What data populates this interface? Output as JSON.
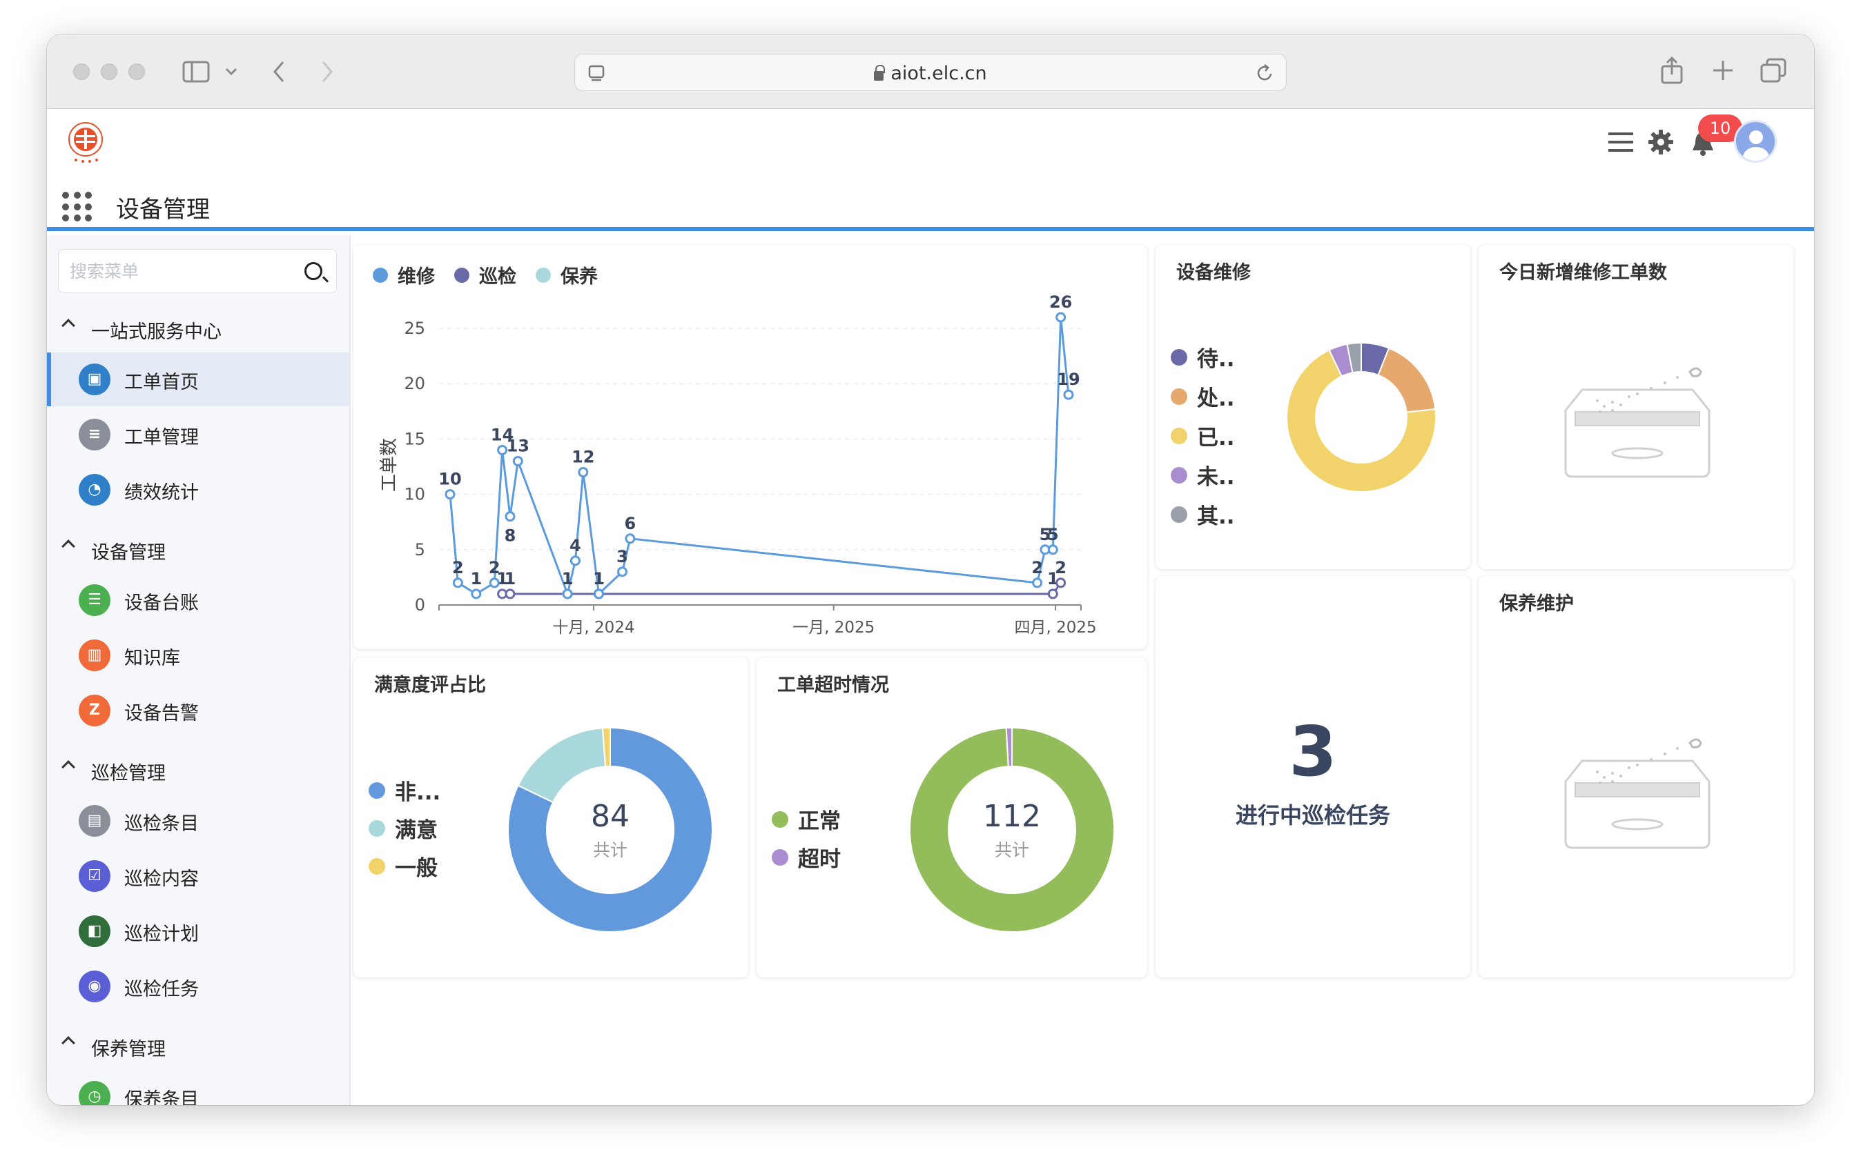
{
  "browser": {
    "url": "aiot.elc.cn"
  },
  "header": {
    "page_title": "设备管理",
    "notification_count": "10"
  },
  "sidebar": {
    "search_placeholder": "搜索菜单",
    "groups": [
      {
        "label": "一站式服务中心",
        "items": [
          {
            "label": "工单首页",
            "icon": "clipboard-icon",
            "color": "#2f7fc9"
          },
          {
            "label": "工单管理",
            "icon": "list-icon",
            "color": "#8a8f99"
          },
          {
            "label": "绩效统计",
            "icon": "chart-icon",
            "color": "#2f7fc9"
          }
        ]
      },
      {
        "label": "设备管理",
        "items": [
          {
            "label": "设备台账",
            "icon": "ledger-icon",
            "color": "#4caf50"
          },
          {
            "label": "知识库",
            "icon": "book-icon",
            "color": "#f06a3a"
          },
          {
            "label": "设备告警",
            "icon": "alarm-icon",
            "color": "#f06a3a"
          }
        ]
      },
      {
        "label": "巡检管理",
        "items": [
          {
            "label": "巡检条目",
            "icon": "document-icon",
            "color": "#8a8f99"
          },
          {
            "label": "巡检内容",
            "icon": "checklist-icon",
            "color": "#5b5fd6"
          },
          {
            "label": "巡检计划",
            "icon": "plan-icon",
            "color": "#2f6e3b"
          },
          {
            "label": "巡检任务",
            "icon": "task-icon",
            "color": "#5b5fd6"
          }
        ]
      },
      {
        "label": "保养管理",
        "items": [
          {
            "label": "保养条目",
            "icon": "clock-icon",
            "color": "#4caf50"
          }
        ]
      }
    ]
  },
  "colors": {
    "accent": "#3f8ee4",
    "repair": "#5b9bdc",
    "inspect": "#6b6aa8",
    "maintain": "#a8d8dc"
  },
  "line_card": {
    "legend": [
      "维修",
      "巡检",
      "保养"
    ],
    "ylabel": "工单数"
  },
  "chart_data": [
    {
      "type": "line",
      "title": "",
      "ylabel": "工单数",
      "ylim": [
        0,
        25
      ],
      "yticks": [
        0,
        5,
        10,
        15,
        20,
        25
      ],
      "xticks": [
        "十月, 2024",
        "一月, 2025",
        "四月, 2025"
      ],
      "series": [
        {
          "name": "维修",
          "color": "#5b9bdc",
          "x": [
            "2024-08-07",
            "2024-08-10",
            "2024-08-17",
            "2024-08-24",
            "2024-08-27",
            "2024-08-30",
            "2024-09-02",
            "2024-09-21",
            "2024-09-24",
            "2024-09-27",
            "2024-10-03",
            "2024-10-12",
            "2024-10-15",
            "2024-03-20",
            "2025-03-20",
            "2025-03-23",
            "2025-03-26",
            "2025-03-29",
            "2025-04-01"
          ],
          "points": [
            {
              "x": "2024-08-07",
              "y": 10
            },
            {
              "x": "2024-08-10",
              "y": 2
            },
            {
              "x": "2024-08-17",
              "y": 1
            },
            {
              "x": "2024-08-24",
              "y": 2
            },
            {
              "x": "2024-08-27",
              "y": 14
            },
            {
              "x": "2024-08-30",
              "y": 8
            },
            {
              "x": "2024-09-02",
              "y": 13
            },
            {
              "x": "2024-09-21",
              "y": 1
            },
            {
              "x": "2024-09-24",
              "y": 4
            },
            {
              "x": "2024-09-27",
              "y": 12
            },
            {
              "x": "2024-10-03",
              "y": 1
            },
            {
              "x": "2024-10-12",
              "y": 3
            },
            {
              "x": "2024-10-15",
              "y": 6
            },
            {
              "x": "2025-03-20",
              "y": 2
            },
            {
              "x": "2025-03-23",
              "y": 5
            },
            {
              "x": "2025-03-26",
              "y": 5
            },
            {
              "x": "2025-03-29",
              "y": 26
            },
            {
              "x": "2025-04-01",
              "y": 19
            }
          ]
        },
        {
          "name": "巡检",
          "color": "#6b6aa8",
          "points": [
            {
              "x": "2024-08-27",
              "y": 1
            },
            {
              "x": "2024-08-30",
              "y": 1
            },
            {
              "x": "2024-09-21",
              "y": 1
            },
            {
              "x": "2024-10-03",
              "y": 1
            },
            {
              "x": "2025-03-26",
              "y": 1
            },
            {
              "x": "2025-03-29",
              "y": 2
            }
          ]
        }
      ]
    },
    {
      "type": "pie",
      "title": "设备维修",
      "legend": [
        "待..",
        "处..",
        "已..",
        "未..",
        "其.."
      ],
      "slices": [
        {
          "label": "待..",
          "value": 6,
          "color": "#6b6aa8"
        },
        {
          "label": "处..",
          "value": 17,
          "color": "#e6a86c"
        },
        {
          "label": "已..",
          "value": 69,
          "color": "#f2d36b"
        },
        {
          "label": "未..",
          "value": 4,
          "color": "#a98dd0"
        },
        {
          "label": "其..",
          "value": 3,
          "color": "#9aa0aa"
        }
      ]
    },
    {
      "type": "pie",
      "title": "满意度评占比",
      "total": "84",
      "total_label": "共计",
      "legend": [
        "非...",
        "满意",
        "一般"
      ],
      "slices": [
        {
          "label": "非...",
          "value": 69,
          "color": "#6199dc"
        },
        {
          "label": "满意",
          "value": 14,
          "color": "#a8d8dc"
        },
        {
          "label": "一般",
          "value": 1,
          "color": "#f2d36b"
        }
      ]
    },
    {
      "type": "pie",
      "title": "工单超时情况",
      "total": "112",
      "total_label": "共计",
      "legend": [
        "正常",
        "超时"
      ],
      "slices": [
        {
          "label": "正常",
          "value": 111,
          "color": "#92bd5a"
        },
        {
          "label": "超时",
          "value": 1,
          "color": "#a98dd0"
        }
      ]
    }
  ],
  "cards": {
    "repair_title": "设备维修",
    "new_today_title": "今日新增维修工单数",
    "satisfaction_title": "满意度评占比",
    "timeout_title": "工单超时情况",
    "inspect_count": "3",
    "inspect_label": "进行中巡检任务",
    "maintain_title": "保养维护"
  }
}
